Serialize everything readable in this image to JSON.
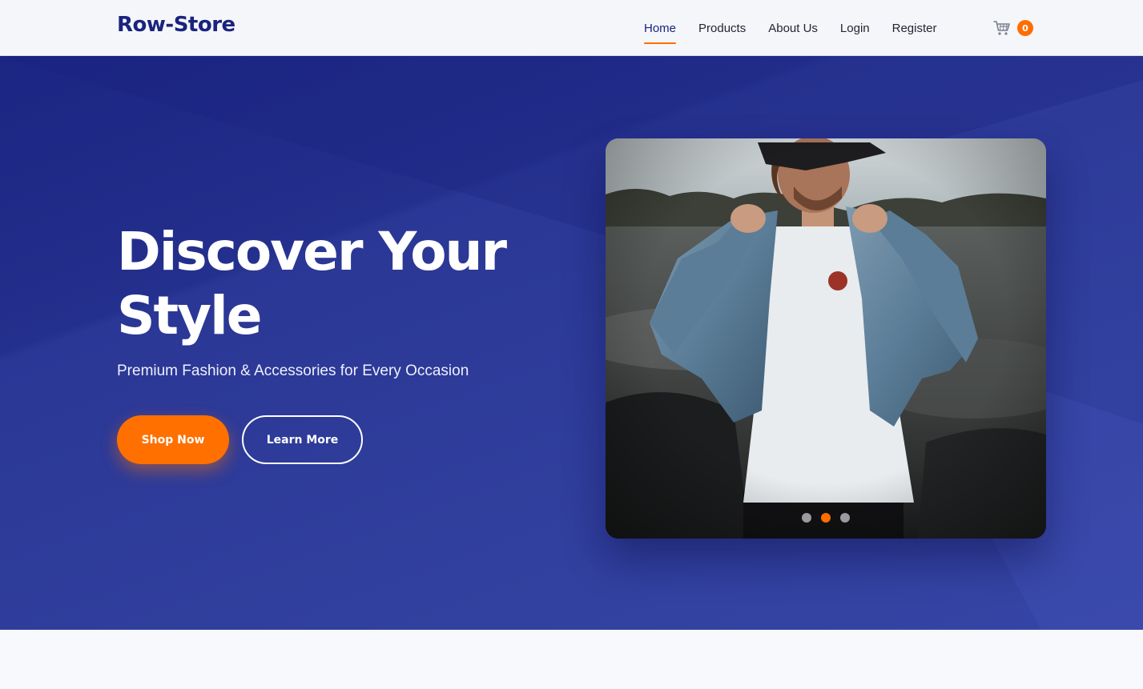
{
  "brand": "Row-Store",
  "nav": {
    "links": [
      {
        "label": "Home",
        "active": true
      },
      {
        "label": "Products",
        "active": false
      },
      {
        "label": "About Us",
        "active": false
      },
      {
        "label": "Login",
        "active": false
      },
      {
        "label": "Register",
        "active": false
      }
    ],
    "cart_icon": "shopping-cart-icon",
    "cart_count": "0"
  },
  "hero": {
    "title_line1": "Discover Your",
    "title_line2": "Style",
    "subtitle": "Premium Fashion & Accessories for Every Occasion",
    "primary_button": "Shop Now",
    "secondary_button": "Learn More",
    "carousel_slide_count": 3,
    "carousel_active_index": 1
  },
  "colors": {
    "brand": "#1a237e",
    "accent": "#ff6d00",
    "hero_bg": "#2d3a98"
  }
}
